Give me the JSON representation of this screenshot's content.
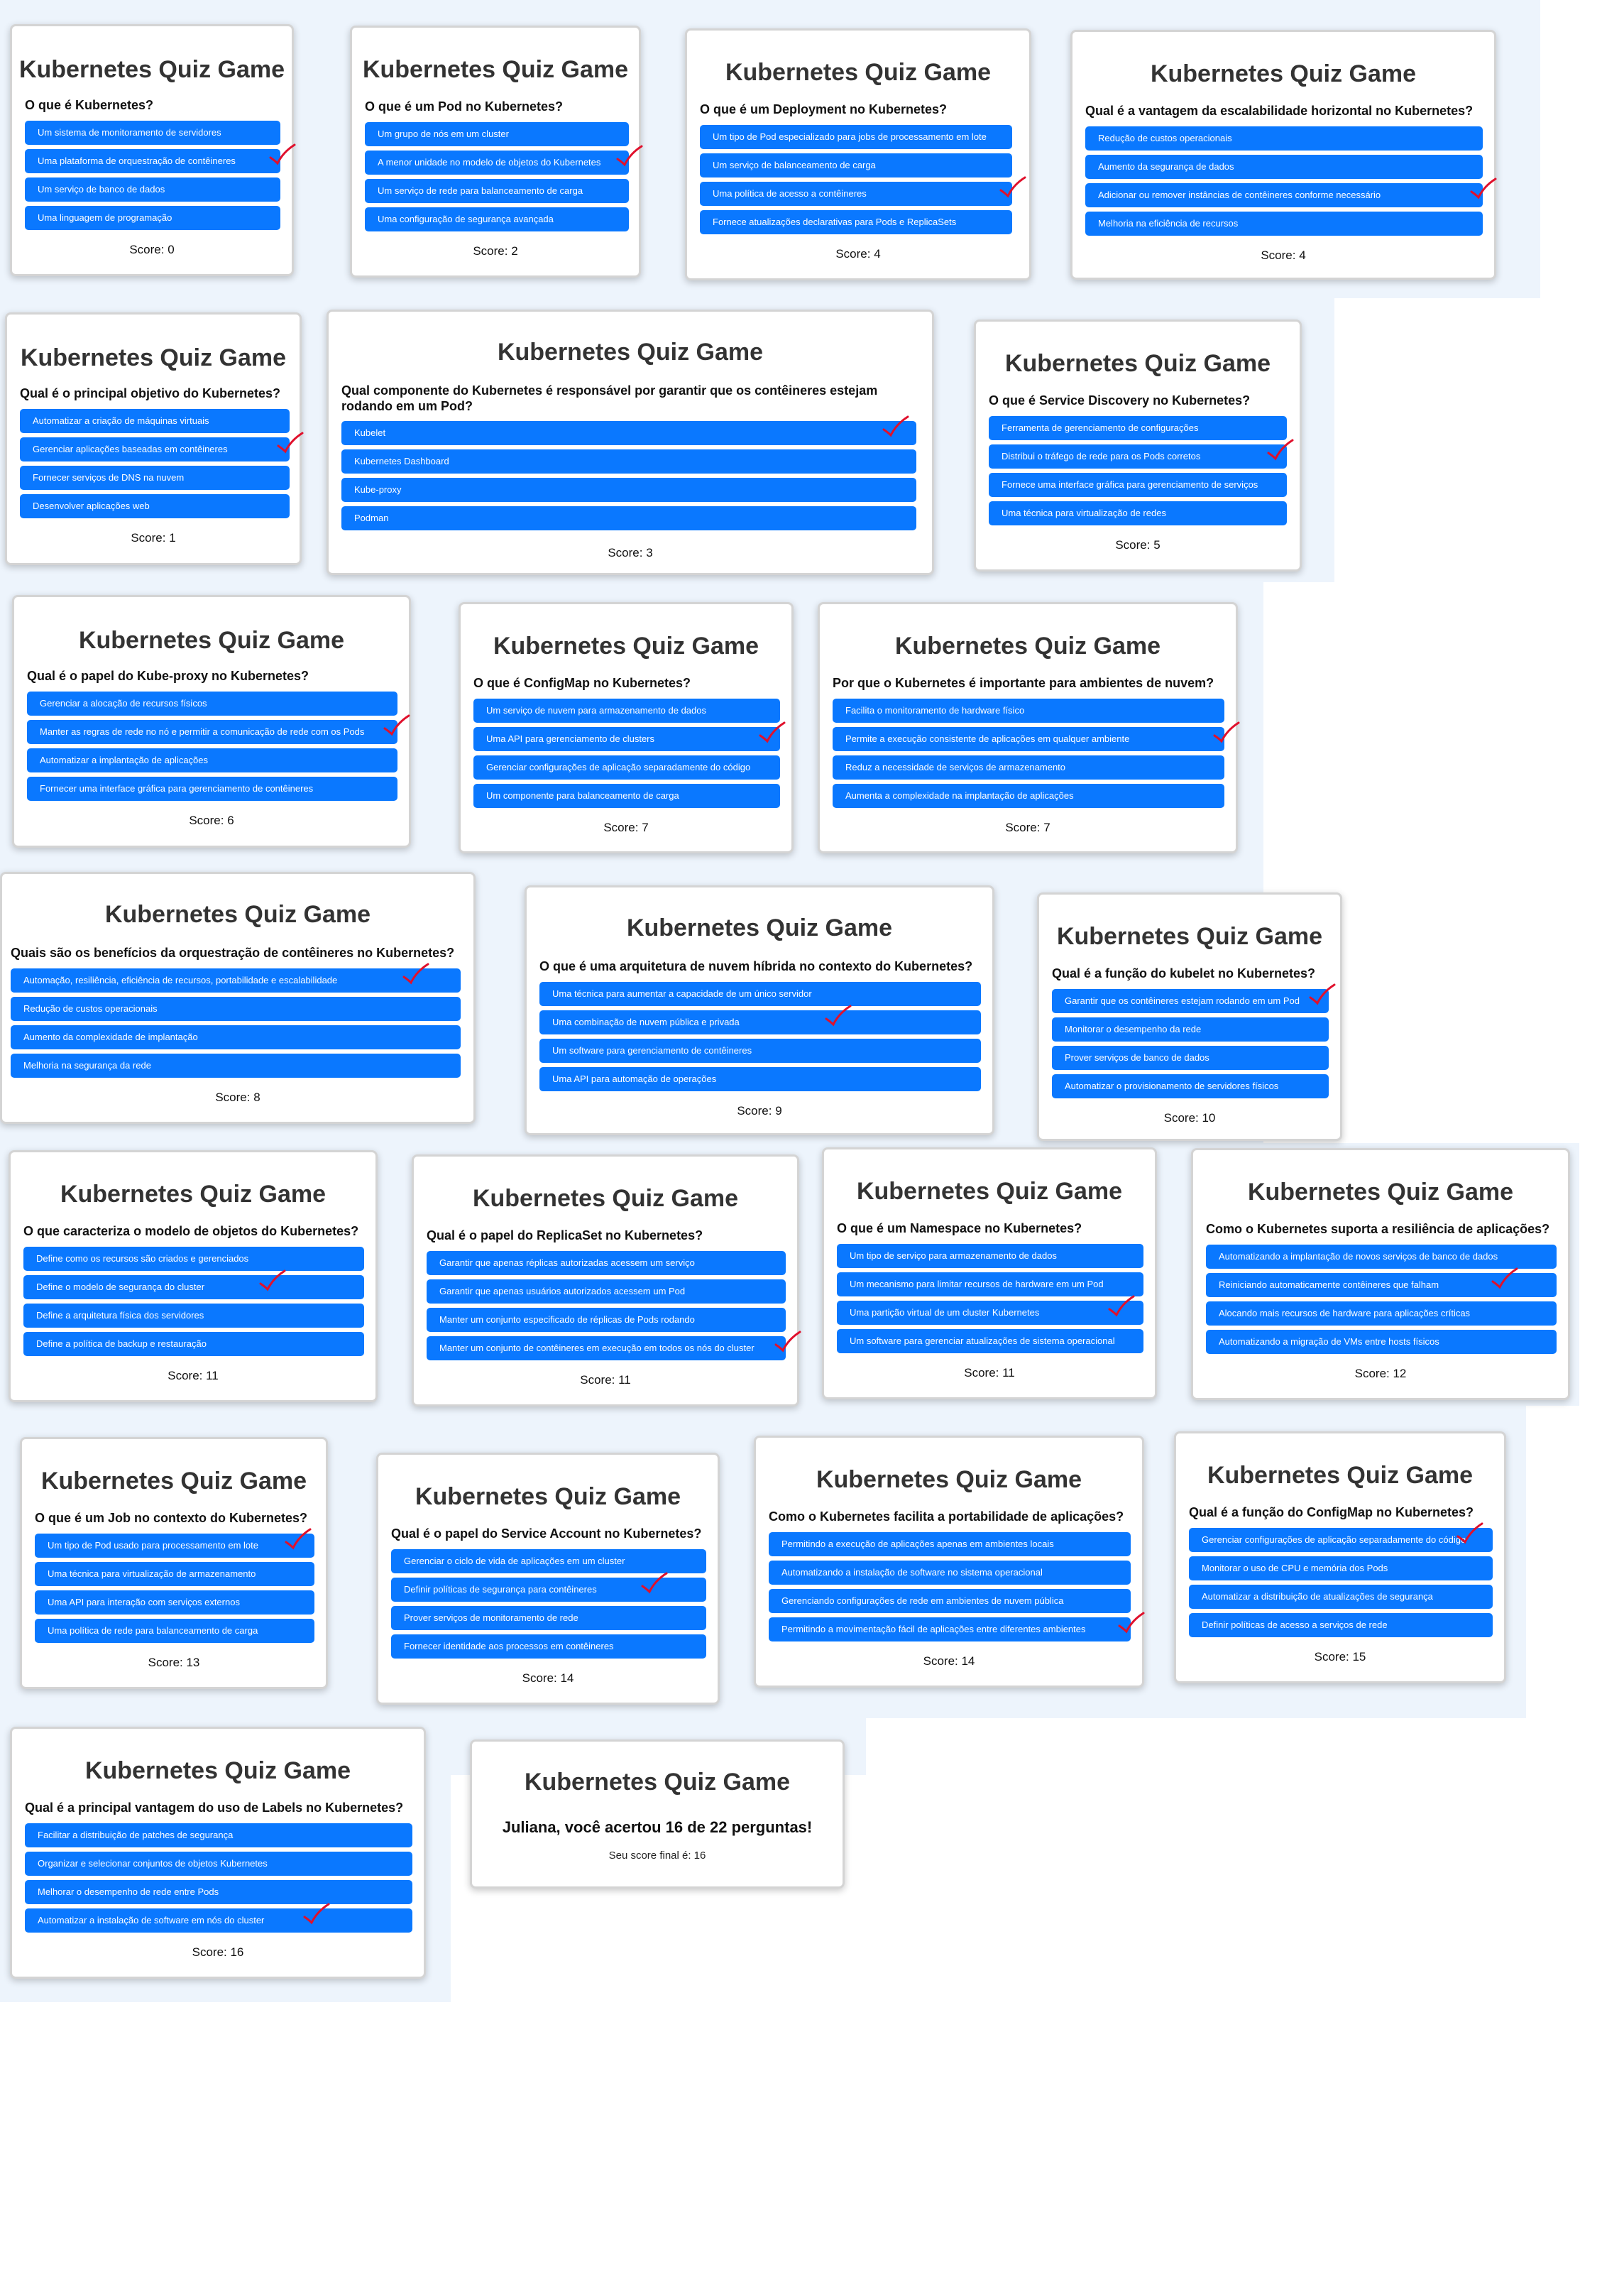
{
  "app_title": "Kubernetes Quiz Game",
  "score_prefix": "Score: ",
  "check_color": "#e0102c",
  "option_color": "#0a78ff",
  "cards": [
    {
      "question": "O que é Kubernetes?",
      "options": [
        "Um sistema de monitoramento de servidores",
        "Uma plataforma de orquestração de contêineres",
        "Um serviço de banco de dados",
        "Uma linguagem de programação"
      ],
      "checked": 1,
      "score": "0"
    },
    {
      "question": "O que é um Pod no Kubernetes?",
      "options": [
        "Um grupo de nós em um cluster",
        "A menor unidade no modelo de objetos do Kubernetes",
        "Um serviço de rede para balanceamento de carga",
        "Uma configuração de segurança avançada"
      ],
      "checked": 1,
      "score": "2"
    },
    {
      "question": "O que é um Deployment no Kubernetes?",
      "options": [
        "Um tipo de Pod especializado para jobs de processamento em lote",
        "Um serviço de balanceamento de carga",
        "Uma política de acesso a contêineres",
        "Fornece atualizações declarativas para Pods e ReplicaSets"
      ],
      "checked": 2,
      "score": "4"
    },
    {
      "question": "Qual é a vantagem da escalabilidade horizontal no Kubernetes?",
      "options": [
        "Redução de custos operacionais",
        "Aumento da segurança de dados",
        "Adicionar ou remover instâncias de contêineres conforme necessário",
        "Melhoria na eficiência de recursos"
      ],
      "checked": 2,
      "score": "4"
    },
    {
      "question": "Qual é o principal objetivo do Kubernetes?",
      "options": [
        "Automatizar a criação de máquinas virtuais",
        "Gerenciar aplicações baseadas em contêineres",
        "Fornecer serviços de DNS na nuvem",
        "Desenvolver aplicações web"
      ],
      "checked": 1,
      "score": "1"
    },
    {
      "question": "Qual componente do Kubernetes é responsável por garantir que os contêineres estejam rodando em um Pod?",
      "options": [
        "Kubelet",
        "Kubernetes Dashboard",
        "Kube-proxy",
        "Podman"
      ],
      "checked": 0,
      "score": "3"
    },
    {
      "question": "O que é Service Discovery no Kubernetes?",
      "options": [
        "Ferramenta de gerenciamento de configurações",
        "Distribui o tráfego de rede para os Pods corretos",
        "Fornece uma interface gráfica para gerenciamento de serviços",
        "Uma técnica para virtualização de redes"
      ],
      "checked": 1,
      "score": "5"
    },
    {
      "question": "Qual é o papel do Kube-proxy no Kubernetes?",
      "options": [
        "Gerenciar a alocação de recursos físicos",
        "Manter as regras de rede no nó e permitir a comunicação de rede com os Pods",
        "Automatizar a implantação de aplicações",
        "Fornecer uma interface gráfica para gerenciamento de contêineres"
      ],
      "checked": 1,
      "score": "6"
    },
    {
      "question": "O que é ConfigMap no Kubernetes?",
      "options": [
        "Um serviço de nuvem para armazenamento de dados",
        "Uma API para gerenciamento de clusters",
        "Gerenciar configurações de aplicação separadamente do código",
        "Um componente para balanceamento de carga"
      ],
      "checked": 1,
      "score": "7"
    },
    {
      "question": "Por que o Kubernetes é importante para ambientes de nuvem?",
      "options": [
        "Facilita o monitoramento de hardware físico",
        "Permite a execução consistente de aplicações em qualquer ambiente",
        "Reduz a necessidade de serviços de armazenamento",
        "Aumenta a complexidade na implantação de aplicações"
      ],
      "checked": 1,
      "score": "7"
    },
    {
      "question": "Quais são os benefícios da orquestração de contêineres no Kubernetes?",
      "options": [
        "Automação, resiliência, eficiência de recursos, portabilidade e escalabilidade",
        "Redução de custos operacionais",
        "Aumento da complexidade de implantação",
        "Melhoria na segurança da rede"
      ],
      "checked": 0,
      "score": "8"
    },
    {
      "question": "O que é uma arquitetura de nuvem híbrida no contexto do Kubernetes?",
      "options": [
        "Uma técnica para aumentar a capacidade de um único servidor",
        "Uma combinação de nuvem pública e privada",
        "Um software para gerenciamento de contêineres",
        "Uma API para automação de operações"
      ],
      "checked": 1,
      "score": "9"
    },
    {
      "question": "Qual é a função do kubelet no Kubernetes?",
      "options": [
        "Garantir que os contêineres estejam rodando em um Pod",
        "Monitorar o desempenho da rede",
        "Prover serviços de banco de dados",
        "Automatizar o provisionamento de servidores físicos"
      ],
      "checked": 0,
      "score": "10"
    },
    {
      "question": "O que caracteriza o modelo de objetos do Kubernetes?",
      "options": [
        "Define como os recursos são criados e gerenciados",
        "Define o modelo de segurança do cluster",
        "Define a arquitetura física dos servidores",
        "Define a política de backup e restauração"
      ],
      "checked": 1,
      "score": "11"
    },
    {
      "question": "Qual é o papel do ReplicaSet no Kubernetes?",
      "options": [
        "Garantir que apenas réplicas autorizadas acessem um serviço",
        "Garantir que apenas usuários autorizados acessem um Pod",
        "Manter um conjunto especificado de réplicas de Pods rodando",
        "Manter um conjunto de contêineres em execução em todos os nós do cluster"
      ],
      "checked": 3,
      "score": "11"
    },
    {
      "question": "O que é um Namespace no Kubernetes?",
      "options": [
        "Um tipo de serviço para armazenamento de dados",
        "Um mecanismo para limitar recursos de hardware em um Pod",
        "Uma partição virtual de um cluster Kubernetes",
        "Um software para gerenciar atualizações de sistema operacional"
      ],
      "checked": 2,
      "score": "11"
    },
    {
      "question": "Como o Kubernetes suporta a resiliência de aplicações?",
      "options": [
        "Automatizando a implantação de novos serviços de banco de dados",
        "Reiniciando automaticamente contêineres que falham",
        "Alocando mais recursos de hardware para aplicações críticas",
        "Automatizando a migração de VMs entre hosts físicos"
      ],
      "checked": 1,
      "score": "12"
    },
    {
      "question": "O que é um Job no contexto do Kubernetes?",
      "options": [
        "Um tipo de Pod usado para processamento em lote",
        "Uma técnica para virtualização de armazenamento",
        "Uma API para interação com serviços externos",
        "Uma política de rede para balanceamento de carga"
      ],
      "checked": 0,
      "score": "13"
    },
    {
      "question": "Qual é o papel do Service Account no Kubernetes?",
      "options": [
        "Gerenciar o ciclo de vida de aplicações em um cluster",
        "Definir políticas de segurança para contêineres",
        "Prover serviços de monitoramento de rede",
        "Fornecer identidade aos processos em contêineres"
      ],
      "checked": 1,
      "score": "14"
    },
    {
      "question": "Como o Kubernetes facilita a portabilidade de aplicações?",
      "options": [
        "Permitindo a execução de aplicações apenas em ambientes locais",
        "Automatizando a instalação de software no sistema operacional",
        "Gerenciando configurações de rede em ambientes de nuvem pública",
        "Permitindo a movimentação fácil de aplicações entre diferentes ambientes"
      ],
      "checked": 3,
      "score": "14"
    },
    {
      "question": "Qual é a função do ConfigMap no Kubernetes?",
      "options": [
        "Gerenciar configurações de aplicação separadamente do código",
        "Monitorar o uso de CPU e memória dos Pods",
        "Automatizar a distribuição de atualizações de segurança",
        "Definir políticas de acesso a serviços de rede"
      ],
      "checked": 0,
      "score": "15"
    },
    {
      "question": "Qual é a principal vantagem do uso de Labels no Kubernetes?",
      "options": [
        "Facilitar a distribuição de patches de segurança",
        "Organizar e selecionar conjuntos de objetos Kubernetes",
        "Melhorar o desempenho de rede entre Pods",
        "Automatizar a instalação de software em nós do cluster"
      ],
      "checked": 3,
      "score": "16"
    }
  ],
  "final": {
    "message": "Juliana, você acertou 16 de 22 perguntas!",
    "score_text": "Seu score final é: 16"
  }
}
